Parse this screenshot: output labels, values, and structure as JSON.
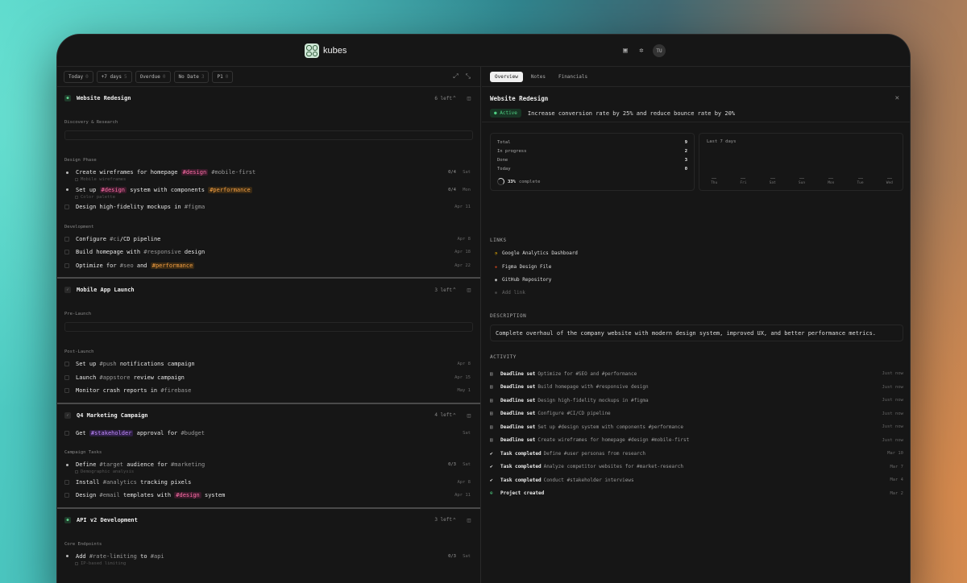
{
  "app": {
    "name": "kubes",
    "avatar": "TU"
  },
  "filters": [
    {
      "label": "Today",
      "count": "0"
    },
    {
      "label": "+7 days",
      "count": "5"
    },
    {
      "label": "Overdue",
      "count": "0"
    },
    {
      "label": "No Date",
      "count": "3"
    },
    {
      "label": "P1",
      "count": "0"
    }
  ],
  "projects": [
    {
      "name": "Website Redesign",
      "left": "6 left"
    },
    {
      "name": "Mobile App Launch",
      "left": "3 left"
    },
    {
      "name": "Q4 Marketing Campaign",
      "left": "4 left"
    },
    {
      "name": "API v2 Development",
      "left": "3 left"
    }
  ],
  "p1": {
    "sec1": "Discovery & Research",
    "sec2": "Design Phase",
    "sec3": "Development",
    "t1": {
      "a": "Create wireframes for homepage",
      "tag1": "#design",
      "tag2": "#mobile-first",
      "prog": "0/4",
      "date": "Sat",
      "sub": "Mobile wireframes"
    },
    "t2": {
      "a": "Set up",
      "tag1": "#design",
      "b": "system with components",
      "tag2": "#performance",
      "prog": "0/4",
      "date": "Mon",
      "sub": "Color palette"
    },
    "t3": {
      "a": "Design high-fidelity mockups in",
      "tag1": "#figma",
      "date": "Apr 11"
    },
    "t4": {
      "a": "Configure",
      "tag1": "#ci",
      "b": "/CD pipeline",
      "date": "Apr 8"
    },
    "t5": {
      "a": "Build homepage with",
      "tag1": "#responsive",
      "b": "design",
      "date": "Apr 18"
    },
    "t6": {
      "a": "Optimize for",
      "tag1": "#seo",
      "b": "and",
      "tag2": "#performance",
      "date": "Apr 22"
    }
  },
  "p2": {
    "sec1": "Pre-Launch",
    "sec2": "Post-Launch",
    "t1": {
      "a": "Set up",
      "tag1": "#push",
      "b": "notifications campaign",
      "date": "Apr 8"
    },
    "t2": {
      "a": "Launch",
      "tag1": "#appstore",
      "b": "review campaign",
      "date": "Apr 15"
    },
    "t3": {
      "a": "Monitor crash reports in",
      "tag1": "#firebase",
      "date": "May 1"
    }
  },
  "p3": {
    "t0": {
      "a": "Get",
      "tag1": "#stakeholder",
      "b": "approval for",
      "tag2": "#budget",
      "date": "Sat"
    },
    "sec1": "Campaign Tasks",
    "t1": {
      "a": "Define",
      "tag1": "#target",
      "b": "audience for",
      "tag2": "#marketing",
      "prog": "0/3",
      "date": "Sat",
      "sub": "Demographic analysis"
    },
    "t2": {
      "a": "Install",
      "tag1": "#analytics",
      "b": "tracking pixels",
      "date": "Apr 8"
    },
    "t3": {
      "a": "Design",
      "tag1": "#email",
      "b": "templates with",
      "tag2": "#design",
      "c": "system",
      "date": "Apr 11"
    }
  },
  "p4": {
    "sec1": "Core Endpoints",
    "t1": {
      "a": "Add",
      "tag1": "#rate-limiting",
      "b": "to",
      "tag2": "#api",
      "prog": "0/3",
      "date": "Sat",
      "sub": "IP-based limiting"
    }
  },
  "tabs": [
    "Overview",
    "Notes",
    "Financials"
  ],
  "detail": {
    "title": "Website Redesign",
    "status": "Active",
    "goal": "Increase conversion rate by 25% and reduce bounce rate by 20%",
    "stats": [
      {
        "label": "Total",
        "value": "9"
      },
      {
        "label": "In progress",
        "value": "2"
      },
      {
        "label": "Done",
        "value": "3"
      },
      {
        "label": "Today",
        "value": "0"
      }
    ],
    "progress_pct": "33%",
    "progress_label": "complete",
    "week_label": "Last 7 days",
    "week_days": [
      "Thu",
      "Fri",
      "Sat",
      "Sun",
      "Mon",
      "Tue",
      "Wed"
    ],
    "links_heading": "LINKS",
    "links": [
      "Google Analytics Dashboard",
      "Figma Design File",
      "GitHub Repository"
    ],
    "add_link": "Add link",
    "desc_heading": "DESCRIPTION",
    "description": "Complete overhaul of the company website with modern design system, improved UX, and better performance metrics.",
    "activity_heading": "ACTIVITY",
    "activity": [
      {
        "type": "Deadline set",
        "detail": "Optimize for #SEO and #performance",
        "time": "Just now"
      },
      {
        "type": "Deadline set",
        "detail": "Build homepage with #responsive design",
        "time": "Just now"
      },
      {
        "type": "Deadline set",
        "detail": "Design high-fidelity mockups in #figma",
        "time": "Just now"
      },
      {
        "type": "Deadline set",
        "detail": "Configure #CI/CD pipeline",
        "time": "Just now"
      },
      {
        "type": "Deadline set",
        "detail": "Set up #design system with components #performance",
        "time": "Just now"
      },
      {
        "type": "Deadline set",
        "detail": "Create wireframes for homepage #design #mobile-first",
        "time": "Just now"
      },
      {
        "type": "Task completed",
        "detail": "Define #user personas from research",
        "time": "Mar 10"
      },
      {
        "type": "Task completed",
        "detail": "Analyze competitor websites for #market-research",
        "time": "Mar 7"
      },
      {
        "type": "Task completed",
        "detail": "Conduct #stakeholder interviews",
        "time": "Mar 4"
      },
      {
        "type": "Project created",
        "detail": "",
        "time": "Mar 2"
      }
    ]
  }
}
